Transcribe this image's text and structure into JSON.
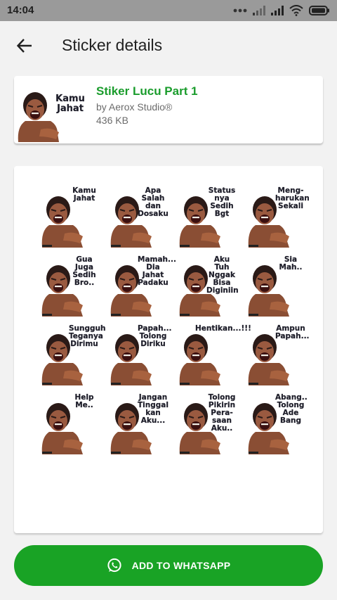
{
  "status_bar": {
    "time": "14:04"
  },
  "header": {
    "title": "Sticker details",
    "back_icon": "arrow-back-icon"
  },
  "pack": {
    "name": "Stiker Lucu Part 1",
    "publisher": "by Aerox Studio®",
    "size": "436 KB",
    "tray_caption": "Kamu\nJahat"
  },
  "stickers": [
    "Kamu\nJahat",
    "Apa\nSalah\ndan\nDosaku",
    "Status\nnya\nSedih\nBgt",
    "Meng-\nharukan\nSekali",
    "Gua\nJuga\nSedih\nBro..",
    "Mamah...\nDia\nJahat\nPadaku",
    "Aku Tuh\nNggak\nBisa\nDiginiin",
    "Sia\nMah..",
    "Sungguh\nTeganya\nDirimu",
    "Papah...\nTolong\nDiriku",
    "Hentikan...!!!",
    "Ampun\nPapah...",
    "Help\nMe..",
    "Jangan\nTinggal\nkan\nAku...",
    "Tolong\nPikirin\nPera-\nsaan\nAku..",
    "Abang..\nTolong\nAde\nBang"
  ],
  "add_button": {
    "label": "ADD TO WHATSAPP",
    "icon": "whatsapp-icon"
  },
  "colors": {
    "accent": "#19a325",
    "pack_name": "#1a9c2c",
    "status_bar": "#9a9a9a"
  }
}
